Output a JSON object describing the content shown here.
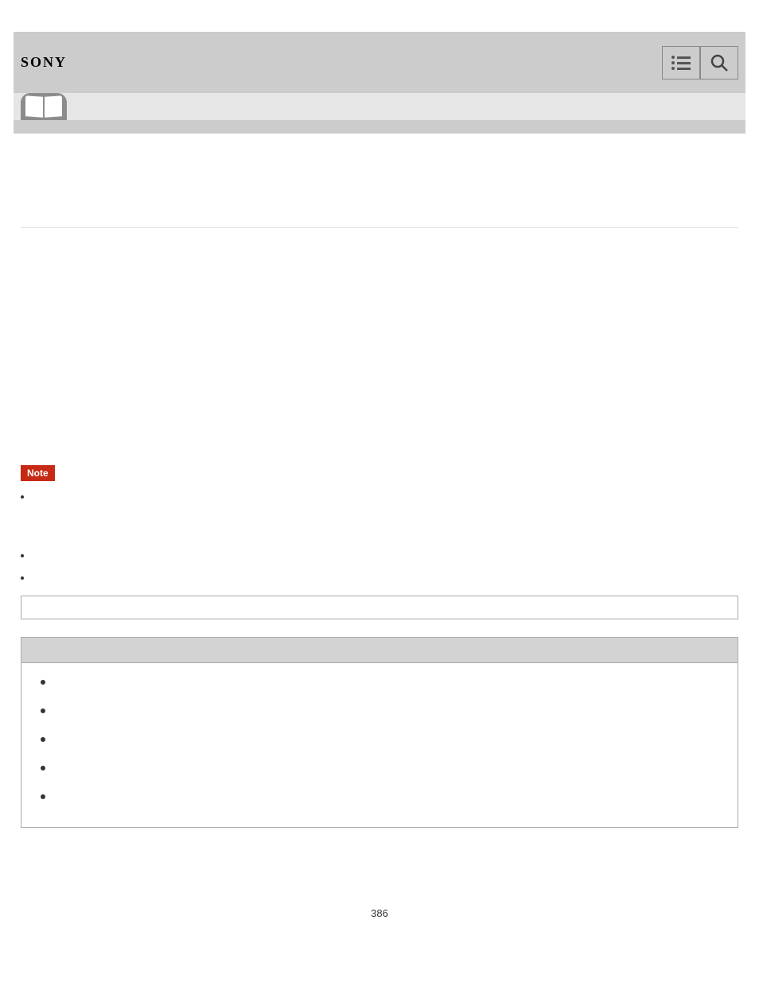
{
  "header": {
    "brand": "SONY"
  },
  "icons": {
    "list": "list-icon",
    "search": "search-icon",
    "book": "open-book-icon"
  },
  "note": {
    "label": "Note"
  },
  "bullets": [
    "",
    "",
    ""
  ],
  "hint_bullets": [
    "",
    ""
  ],
  "related": {
    "title": "",
    "items": [
      "",
      "",
      "",
      "",
      ""
    ]
  },
  "pageNumber": "386"
}
